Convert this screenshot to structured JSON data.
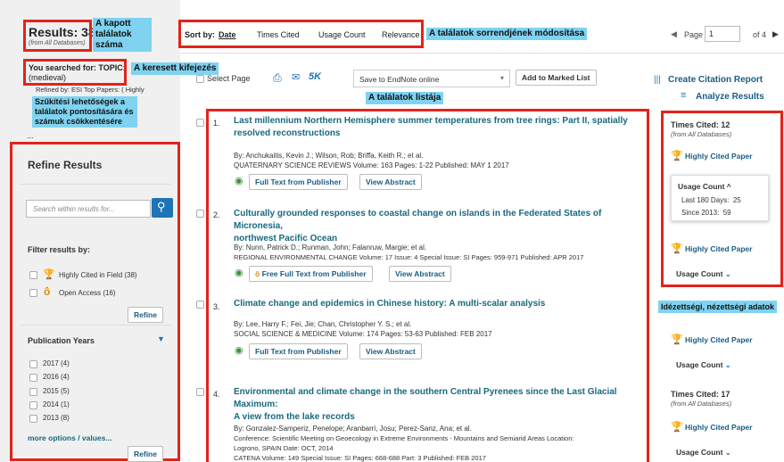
{
  "left": {
    "results_label": "Results: 38",
    "results_sub": "(from All Databases)",
    "you_searched": "You searched for:",
    "topic": "TOPIC:",
    "topic_value": "(medieval)",
    "refined_by": "Refined by: ESI Top Papers: ( Highly",
    "ellipsis": "...",
    "refine_header": "Refine Results",
    "search_placeholder": "Search within results for...",
    "filter_by": "Filter results by:",
    "filter_items": [
      "Highly Cited in Field (38)",
      "Open Access (16)"
    ],
    "refine_btn": "Refine",
    "pub_years_header": "Publication Years",
    "years": [
      "2017 (4)",
      "2016 (4)",
      "2015 (5)",
      "2014 (1)",
      "2013 (8)"
    ],
    "more_options": "more options / values...",
    "refine_btn2": "Refine"
  },
  "sort": {
    "label": "Sort by:",
    "options": [
      "Date",
      "Times Cited",
      "Usage Count",
      "Relevance"
    ]
  },
  "pagination": {
    "page_label": "Page",
    "page_value": "1",
    "of_label": "of 4"
  },
  "toolbar": {
    "select_page": "Select Page",
    "count_5k": "5K",
    "save_to": "Save to EndNote online",
    "add_marked": "Add to Marked List"
  },
  "right_links": {
    "citation_report": "Create Citation Report",
    "analyze": "Analyze Results"
  },
  "annotations": {
    "kapott": "A kapott találatok száma",
    "sorrend": "A találatok sorrendjének módosítása",
    "keresett": "A keresett kifejezés",
    "szukitesi": "Szűkítési lehetőségek a találatok pontosítására és számuk csökkentésére",
    "lista": "A találatok listája",
    "idezettsegi": "Idézettségi, nézettségi adatok"
  },
  "records": [
    {
      "n": "1.",
      "title_l1": "Last millennium Northern Hemisphere summer temperatures from tree rings: Part II, spatially",
      "title_l2": "resolved reconstructions",
      "authors": "By: Anchukaitis, Kevin J.; Wilson, Rob; Briffa, Keith R.; et al.",
      "source": "QUATERNARY SCIENCE REVIEWS  Volume: 163  Pages: 1-22  Published: MAY 1 2017",
      "btn1": "Full Text from Publisher",
      "btn2": "View Abstract"
    },
    {
      "n": "2.",
      "title_l1": "Culturally grounded responses to coastal change on islands in the Federated States of Micronesia,",
      "title_l2": "northwest Pacific Ocean",
      "authors": "By: Nunn, Patrick D.; Runman, John; Falanruw, Margie; et al.",
      "source": "REGIONAL ENVIRONMENTAL CHANGE  Volume: 17  Issue: 4  Special Issue: SI  Pages: 959-971  Published: APR 2017",
      "btn1": "Free Full Text from Publisher",
      "btn2": "View Abstract"
    },
    {
      "n": "3.",
      "title_l1": "Climate change and epidemics in Chinese history: A multi-scalar analysis",
      "authors": "By: Lee, Harry F.; Fei, Jie; Chan, Christopher Y. S.; et al.",
      "source": "SOCIAL SCIENCE & MEDICINE  Volume: 174  Pages: 53-63  Published: FEB 2017",
      "btn1": "Full Text from Publisher",
      "btn2": "View Abstract"
    },
    {
      "n": "4.",
      "title_l1": "Environmental and climate change in the southern Central Pyrenees since the Last Glacial Maximum:",
      "title_l2": "A view from the lake records",
      "authors": "By: Gonzalez-Samperiz, Penelope; Aranbarri, Josu; Perez-Sanz, Ana; et al.",
      "conference": "Conference: Scientific Meeting on Geoecology in Extreme Environments - Mountains and Semiarid Areas Location:",
      "conference2": "Logrono, SPAIN Date: OCT, 2014",
      "source": "CATENA  Volume: 149  Special Issue: SI  Pages: 668-688  Part: 3  Published: FEB 2017"
    }
  ],
  "metrics": {
    "times_cited_1": "Times Cited: 12",
    "from_all": "(from All Databases)",
    "highly_cited": "Highly Cited Paper",
    "usage_count": "Usage Count",
    "last_180": "Last 180 Days:",
    "last_180_val": "25",
    "since_2013": "Since 2013:",
    "since_2013_val": "59",
    "times_cited_4": "Times Cited: 17",
    "faded": "(from All Databases)"
  }
}
